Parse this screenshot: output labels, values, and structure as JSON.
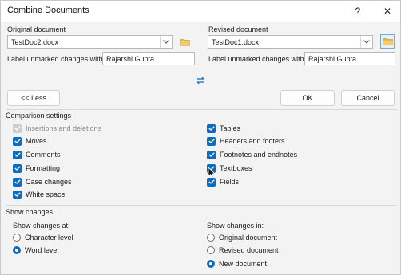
{
  "dialog": {
    "title": "Combine Documents",
    "help_glyph": "?",
    "close_glyph": "✕"
  },
  "original": {
    "header": "Original document",
    "file": "TestDoc2.docx",
    "label_caption": "Label unmarked changes with:",
    "label_value": "Rajarshi Gupta"
  },
  "revised": {
    "header": "Revised document",
    "file": "TestDoc1.docx",
    "label_caption": "Label unmarked changes with:",
    "label_value": "Rajarshi Gupta"
  },
  "buttons": {
    "less": "<< Less",
    "ok": "OK",
    "cancel": "Cancel"
  },
  "comparison": {
    "header": "Comparison settings",
    "left": [
      {
        "label": "Insertions and deletions",
        "checked": true,
        "disabled": true
      },
      {
        "label": "Moves",
        "checked": true,
        "disabled": false
      },
      {
        "label": "Comments",
        "checked": true,
        "disabled": false
      },
      {
        "label": "Formatting",
        "checked": true,
        "disabled": false
      },
      {
        "label": "Case changes",
        "checked": true,
        "disabled": false
      },
      {
        "label": "White space",
        "checked": true,
        "disabled": false
      }
    ],
    "right": [
      {
        "label": "Tables",
        "checked": true
      },
      {
        "label": "Headers and footers",
        "checked": true
      },
      {
        "label": "Footnotes and endnotes",
        "checked": true
      },
      {
        "label": "Textboxes",
        "checked": true
      },
      {
        "label": "Fields",
        "checked": true
      }
    ]
  },
  "show_changes": {
    "header": "Show changes",
    "at_label": "Show changes at:",
    "at_options": [
      {
        "label": "Character level",
        "selected": false
      },
      {
        "label": "Word level",
        "selected": true
      }
    ],
    "in_label": "Show changes in:",
    "in_options": [
      {
        "label": "Original document",
        "selected": false
      },
      {
        "label": "Revised document",
        "selected": false
      },
      {
        "label": "New document",
        "selected": true
      }
    ]
  },
  "colors": {
    "accent": "#0f6cbd",
    "disabled_text": "#8a8a8a"
  },
  "icons": {
    "folder": "folder-icon",
    "swap": "swap-arrows-icon",
    "dropdown": "chevron-down-icon",
    "checkmark": "checkmark-icon"
  }
}
